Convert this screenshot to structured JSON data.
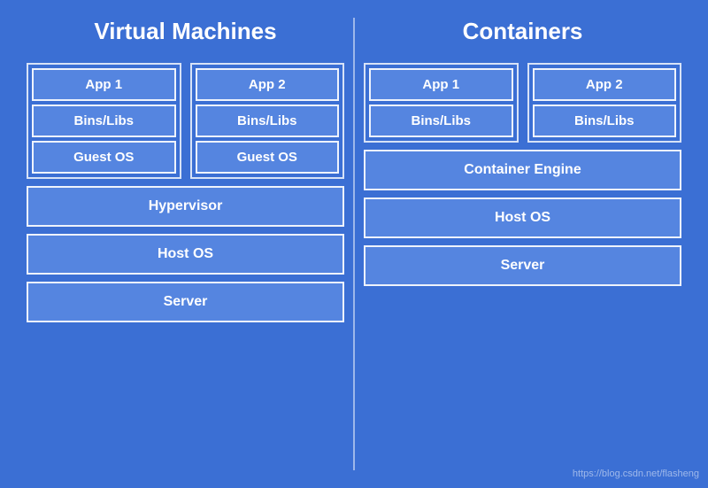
{
  "left_column": {
    "title": "Virtual Machines",
    "group1": {
      "app": "App 1",
      "bins": "Bins/Libs",
      "os": "Guest OS"
    },
    "group2": {
      "app": "App 2",
      "bins": "Bins/Libs",
      "os": "Guest OS"
    },
    "hypervisor": "Hypervisor",
    "host_os": "Host OS",
    "server": "Server"
  },
  "right_column": {
    "title": "Containers",
    "group1": {
      "app": "App 1",
      "bins": "Bins/Libs"
    },
    "group2": {
      "app": "App 2",
      "bins": "Bins/Libs"
    },
    "container_engine": "Container Engine",
    "host_os": "Host OS",
    "server": "Server"
  },
  "watermark": "https://blog.csdn.net/flasheng"
}
